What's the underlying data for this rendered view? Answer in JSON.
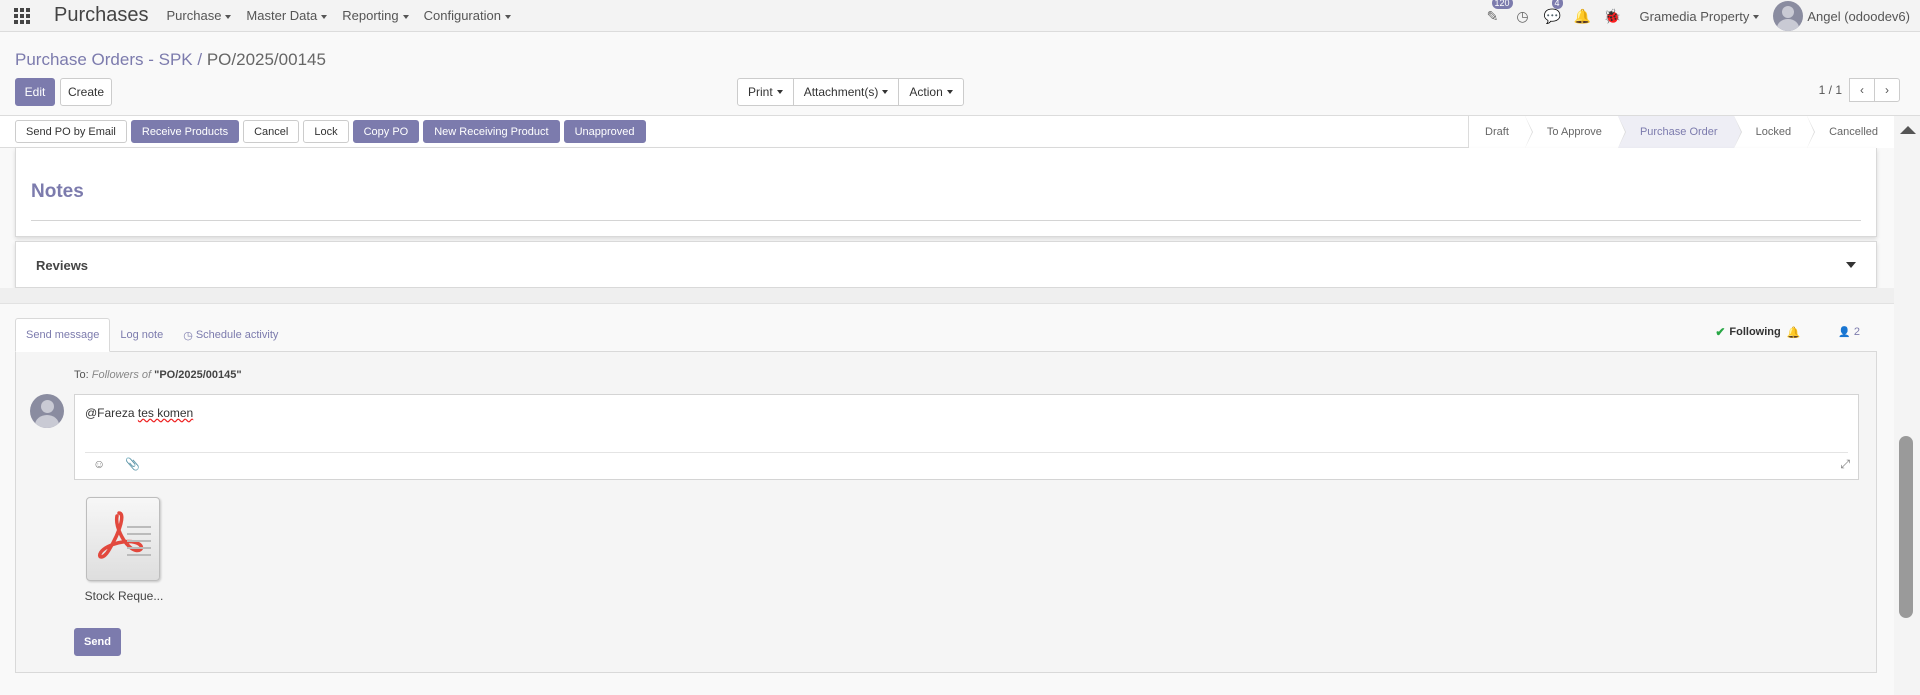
{
  "navbar": {
    "app_title": "Purchases",
    "menus": [
      "Purchase",
      "Master Data",
      "Reporting",
      "Configuration"
    ],
    "activity_badge": "120",
    "messages_badge": "4",
    "company": "Gramedia Property",
    "user": "Angel (odoodev6)"
  },
  "control_panel": {
    "breadcrumb_parent": "Purchase Orders - SPK",
    "breadcrumb_separator": "/",
    "breadcrumb_current": "PO/2025/00145",
    "edit_label": "Edit",
    "create_label": "Create",
    "print_label": "Print",
    "attachments_label": "Attachment(s)",
    "action_label": "Action",
    "pager": "1 / 1"
  },
  "statusbar": {
    "buttons": [
      "Send PO by Email",
      "Receive Products",
      "Cancel",
      "Lock",
      "Copy PO",
      "New Receiving Product",
      "Unapproved"
    ],
    "stages": [
      "Draft",
      "To Approve",
      "Purchase Order",
      "Locked",
      "Cancelled"
    ],
    "active_stage": "Purchase Order"
  },
  "sheet": {
    "notes_title": "Notes",
    "reviews_title": "Reviews"
  },
  "chatter": {
    "tabs": [
      "Send message",
      "Log note",
      "Schedule activity"
    ],
    "following_label": "Following",
    "followers_count": "2",
    "to_label": "To:",
    "to_followers": "Followers of",
    "to_record": "\"PO/2025/00145\"",
    "message_prefix": "@Fareza ",
    "message_spell": "tes komen",
    "attachment_name": "Stock Reque...",
    "send_label": "Send"
  },
  "colors": {
    "brand": "#7c7bad",
    "following_check": "#28a745"
  }
}
